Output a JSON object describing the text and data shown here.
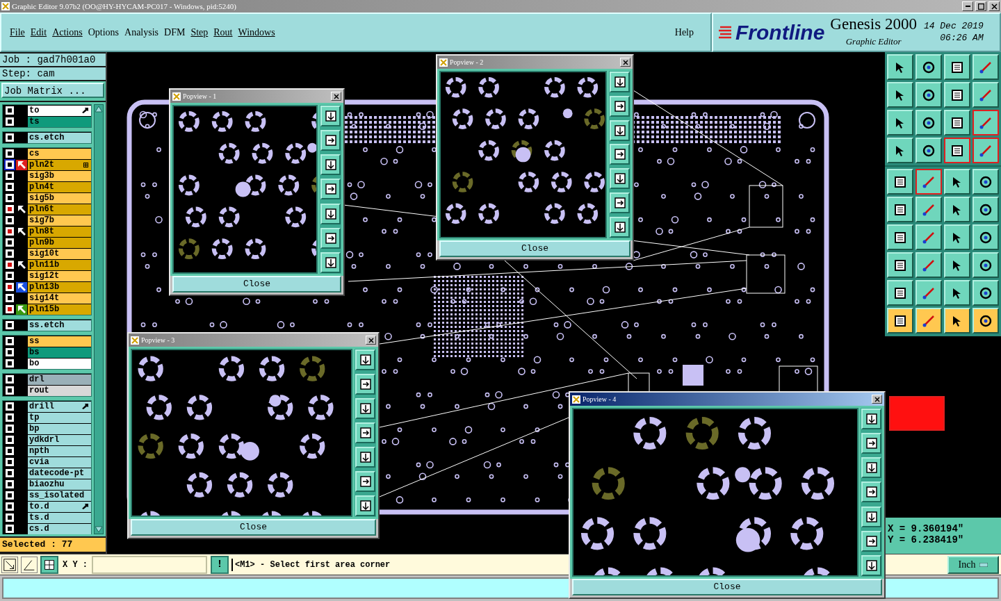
{
  "window": {
    "title": "Graphic Editor 9.07b2 (OO@HY-HYCAM-PC017 - Windows, pid:5240)"
  },
  "menu": [
    {
      "label": "File",
      "underlined": true
    },
    {
      "label": "Edit",
      "underlined": true
    },
    {
      "label": "Actions",
      "underlined": true
    },
    {
      "label": "Options",
      "underlined": false
    },
    {
      "label": "Analysis",
      "underlined": false
    },
    {
      "label": "DFM",
      "underlined": false
    },
    {
      "label": "Step",
      "underlined": true
    },
    {
      "label": "Rout",
      "underlined": true
    },
    {
      "label": "Windows",
      "underlined": true
    }
  ],
  "help": "Help",
  "branding": {
    "logo": "Frontline",
    "product": "Genesis 2000",
    "subtitle": "Graphic Editor",
    "date": "14 Dec 2019",
    "time": "06:26 AM"
  },
  "job": "Job : gad7h001a0",
  "step": "Step: cam",
  "job_matrix_button": "Job Matrix ...",
  "layer_groups": [
    [
      {
        "name": "to",
        "color": "#ffffff",
        "affected": false,
        "selected": false,
        "pointer": true
      },
      {
        "name": "ts",
        "color": "#109a7c",
        "affected": false,
        "selected": false
      }
    ],
    [
      {
        "name": "cs.etch",
        "color": "#9fdcdc",
        "affected": false,
        "selected": false
      }
    ],
    [
      {
        "name": "cs",
        "color": "#ffc850",
        "affected": false,
        "selected": false
      },
      {
        "name": "pln2t",
        "color": "#d8a800",
        "affected": false,
        "selected": true,
        "arrow": {
          "color": "#e02020"
        },
        "grid": true
      },
      {
        "name": "sig3b",
        "color": "#ffc850",
        "affected": false,
        "selected": false
      },
      {
        "name": "pln4t",
        "color": "#d8a800",
        "affected": false,
        "selected": false
      },
      {
        "name": "sig5b",
        "color": "#ffc850",
        "affected": false,
        "selected": false
      },
      {
        "name": "pln6t",
        "color": "#d8a800",
        "affected": true,
        "selected": false,
        "arrow": {
          "color": "#000000"
        }
      },
      {
        "name": "sig7b",
        "color": "#ffc850",
        "affected": false,
        "selected": false
      },
      {
        "name": "pln8t",
        "color": "#d8a800",
        "affected": true,
        "selected": false,
        "arrow": {
          "color": "#000000"
        }
      },
      {
        "name": "pln9b",
        "color": "#d8a800",
        "affected": false,
        "selected": false
      },
      {
        "name": "sig10t",
        "color": "#ffc850",
        "affected": false,
        "selected": false
      },
      {
        "name": "pln11b",
        "color": "#d8a800",
        "affected": true,
        "selected": false,
        "arrow": {
          "color": "#000000"
        }
      },
      {
        "name": "sig12t",
        "color": "#ffc850",
        "affected": false,
        "selected": false
      },
      {
        "name": "pln13b",
        "color": "#d8a800",
        "affected": true,
        "selected": false,
        "arrow": {
          "color": "#1a50e0"
        }
      },
      {
        "name": "sig14t",
        "color": "#ffc850",
        "affected": false,
        "selected": false
      },
      {
        "name": "pln15b",
        "color": "#d8a800",
        "affected": true,
        "selected": false,
        "arrow": {
          "color": "#3a9a10"
        }
      }
    ],
    [
      {
        "name": "ss.etch",
        "color": "#9fdcdc",
        "affected": false,
        "selected": false
      }
    ],
    [
      {
        "name": "ss",
        "color": "#ffc850",
        "affected": false,
        "selected": false
      },
      {
        "name": "bs",
        "color": "#109a7c",
        "affected": false,
        "selected": false
      },
      {
        "name": "bo",
        "color": "#ffffff",
        "affected": false,
        "selected": false
      }
    ],
    [
      {
        "name": "drl",
        "color": "#9ab0b8",
        "affected": false,
        "selected": false
      },
      {
        "name": "rout",
        "color": "#d8d8d8",
        "affected": false,
        "selected": false
      }
    ],
    [
      {
        "name": "drill",
        "color": "#9fdcdc",
        "affected": false,
        "selected": false,
        "pointer": true
      },
      {
        "name": "tp",
        "color": "#9fdcdc",
        "affected": false,
        "selected": false
      },
      {
        "name": "bp",
        "color": "#9fdcdc",
        "affected": false,
        "selected": false
      },
      {
        "name": "ydkdrl",
        "color": "#9fdcdc",
        "affected": false,
        "selected": false
      },
      {
        "name": "npth",
        "color": "#9fdcdc",
        "affected": false,
        "selected": false
      },
      {
        "name": "cvia",
        "color": "#9fdcdc",
        "affected": false,
        "selected": false
      },
      {
        "name": "datecode-pt",
        "color": "#9fdcdc",
        "affected": false,
        "selected": false
      },
      {
        "name": "biaozhu",
        "color": "#9fdcdc",
        "affected": false,
        "selected": false
      },
      {
        "name": "ss_isolated",
        "color": "#9fdcdc",
        "affected": false,
        "selected": false
      },
      {
        "name": "to.d",
        "color": "#9fdcdc",
        "affected": false,
        "selected": false,
        "pointer": true
      },
      {
        "name": "ts.d",
        "color": "#9fdcdc",
        "affected": false,
        "selected": false
      },
      {
        "name": "cs.d",
        "color": "#9fdcdc",
        "affected": false,
        "selected": false
      }
    ]
  ],
  "selected_count": "Selected : 77",
  "popviews": [
    {
      "title": "Popview - 1",
      "close": "Close",
      "active": false
    },
    {
      "title": "Popview - 2",
      "close": "Close",
      "active": false
    },
    {
      "title": "Popview - 3",
      "close": "Close",
      "active": false
    },
    {
      "title": "Popview - 4",
      "close": "Close",
      "active": true
    }
  ],
  "toolbar": {
    "top": [
      {
        "selected": false
      },
      {
        "selected": false
      },
      {
        "selected": false
      },
      {
        "selected": false
      },
      {
        "selected": false
      },
      {
        "selected": false
      },
      {
        "selected": false
      },
      {
        "selected": false
      },
      {
        "selected": false
      },
      {
        "selected": false
      },
      {
        "selected": false
      },
      {
        "selected": true
      },
      {
        "selected": false
      },
      {
        "selected": false
      },
      {
        "selected": true
      },
      {
        "selected": true
      }
    ],
    "bottom": [
      {
        "kind": "draw",
        "selected": false
      },
      {
        "kind": "draw",
        "selected": true
      },
      {
        "kind": "draw",
        "selected": false
      },
      {
        "kind": "draw",
        "selected": false
      },
      {
        "kind": "draw",
        "selected": false
      },
      {
        "kind": "draw",
        "selected": false
      },
      {
        "kind": "draw",
        "selected": false
      },
      {
        "kind": "draw",
        "selected": false
      },
      {
        "kind": "draw",
        "selected": false
      },
      {
        "kind": "draw",
        "selected": false
      },
      {
        "kind": "draw",
        "selected": false
      },
      {
        "kind": "draw",
        "selected": false
      },
      {
        "kind": "draw",
        "selected": false
      },
      {
        "kind": "draw",
        "selected": false
      },
      {
        "kind": "draw",
        "selected": false
      },
      {
        "kind": "draw",
        "selected": false
      },
      {
        "kind": "draw",
        "selected": false
      },
      {
        "kind": "draw",
        "selected": false
      },
      {
        "kind": "draw",
        "selected": false
      },
      {
        "kind": "draw",
        "selected": false
      },
      {
        "kind": "pick",
        "selected": false
      },
      {
        "kind": "pick",
        "selected": false
      },
      {
        "kind": "pick",
        "selected": false
      },
      {
        "kind": "pick",
        "selected": false
      }
    ]
  },
  "coordinates": {
    "x": "X = 9.360194\"",
    "y": "Y = 6.238419\""
  },
  "units_button": "Inch",
  "command_bar": {
    "xy_label": "X Y :",
    "alert": "!",
    "message": "<M1> - Select first area corner"
  }
}
